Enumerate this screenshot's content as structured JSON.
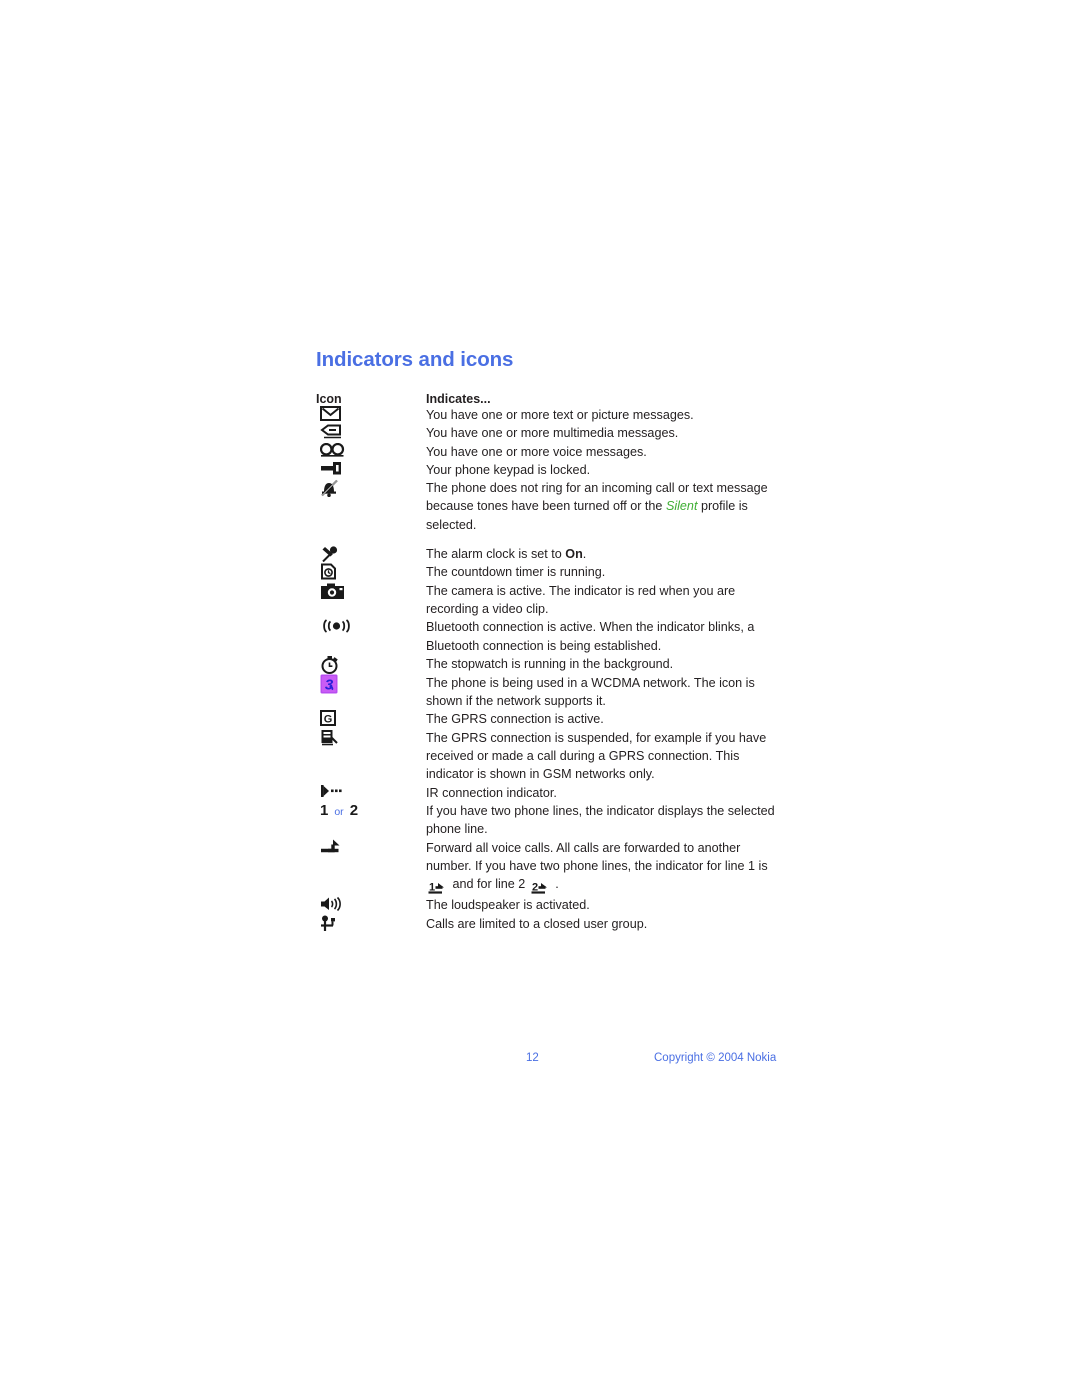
{
  "document": {
    "title": "Indicators and icons",
    "title_color": "#4a6fe3",
    "body_color": "#231f20",
    "accent_green": "#3fae34"
  },
  "table": {
    "header": {
      "icon_column": "Icon",
      "indicates_column": "Indicates..."
    },
    "rows": [
      {
        "icon_name": "envelope-icon",
        "text": "You have one or more text or picture messages."
      },
      {
        "icon_name": "multimedia-message-icon",
        "text": "You have one or more multimedia messages."
      },
      {
        "icon_name": "voice-message-icon",
        "text": "You have one or more voice messages."
      },
      {
        "icon_name": "keypad-lock-key-icon",
        "text": "Your phone keypad is locked."
      },
      {
        "icon_name": "silent-ringer-off-icon",
        "text_part1": "The phone does not ring for an incoming call or text message because tones have been turned off or the ",
        "emphasis": "Silent",
        "text_part2": " profile is selected."
      },
      {
        "icon_name": "alarm-clock-icon",
        "text_part1": "The alarm clock is set to ",
        "emphasis": "On",
        "text_part2": "."
      },
      {
        "icon_name": "countdown-timer-icon",
        "text": "The countdown timer is running."
      },
      {
        "icon_name": "camera-icon",
        "text": "The camera is active. The indicator is red when you are recording a video clip."
      },
      {
        "icon_name": "bluetooth-active-icon",
        "text": "Bluetooth connection is active. When the indicator blinks, a Bluetooth connection is being established."
      },
      {
        "icon_name": "stopwatch-icon",
        "text": "The stopwatch is running in the background."
      },
      {
        "icon_name": "wcdma-3g-network-icon",
        "text": "The phone is being used in a WCDMA network. The icon is shown if the network supports it."
      },
      {
        "icon_name": "gprs-active-icon",
        "text": "The GPRS connection is active."
      },
      {
        "icon_name": "gprs-suspended-icon",
        "text": "The GPRS connection is suspended, for example if you have received or made a call during a GPRS connection. This indicator is shown in GSM networks only."
      },
      {
        "icon_name": "infrared-connection-icon",
        "text": "IR connection indicator."
      },
      {
        "icon_name": "phone-line-selector-icon",
        "icon_label_1": "1",
        "icon_label_or": "or",
        "icon_label_2": "2",
        "text": "If you have two phone lines, the indicator displays the selected phone line."
      },
      {
        "icon_name": "call-forward-all-icon",
        "text_part1": "Forward all voice calls. All calls are forwarded to another number. If you have two phone lines, the indicator for line 1 is ",
        "inline_icon_1": "call-forward-line-1-icon",
        "text_part2": " and for line 2 ",
        "inline_icon_2": "call-forward-line-2-icon",
        "text_part3": " ."
      },
      {
        "icon_name": "loudspeaker-icon",
        "text": "The loudspeaker is activated."
      },
      {
        "icon_name": "closed-user-group-icon",
        "text": "Calls are limited to a closed user group."
      }
    ]
  },
  "footer": {
    "page_number": "12",
    "copyright": "Copyright © 2004 Nokia",
    "color": "#4a6fe3"
  }
}
